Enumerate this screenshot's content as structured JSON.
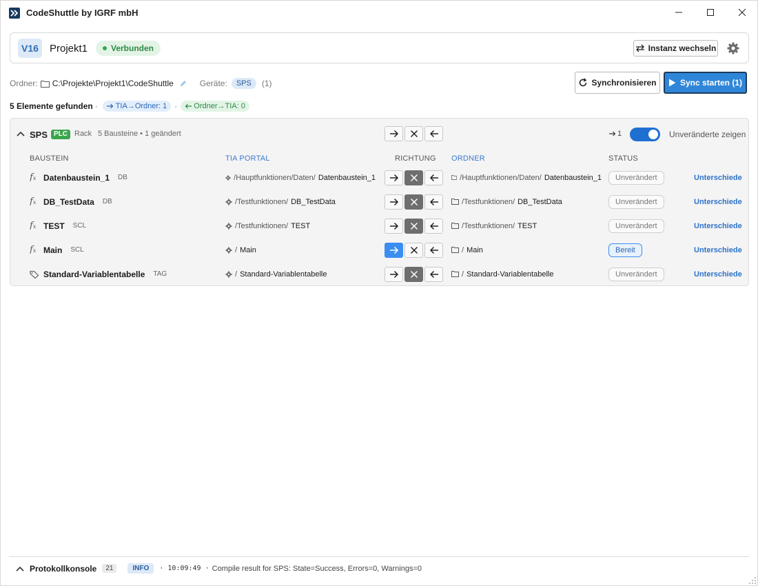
{
  "window": {
    "title": "CodeShuttle by IGRF mbH"
  },
  "header": {
    "version": "V16",
    "project": "Projekt1",
    "status": "Verbunden",
    "switch_label": "Instanz wechseln"
  },
  "info": {
    "folder_label": "Ordner:",
    "folder_path": "C:\\Projekte\\Projekt1\\CodeShuttle",
    "devices_label": "Geräte:",
    "device_chip": "SPS",
    "device_count": "(1)",
    "sync_label": "Synchronisieren",
    "start_label": "Sync starten (1)"
  },
  "summary": {
    "found": "5 Elemente gefunden",
    "sep1": "·",
    "sep2": "·",
    "tia_to_folder": "TIA→Ordner: 1",
    "folder_to_tia": "Ordner→TIA: 0"
  },
  "device": {
    "name": "SPS",
    "badge": "PLC",
    "rack": "Rack",
    "meta": "5 Bausteine • 1 geändert",
    "arrow_count": "1",
    "toggle_label": "Unveränderte zeigen",
    "show_unchanged": true
  },
  "columns": {
    "block": "BAUSTEIN",
    "tia": "TIA PORTAL",
    "direction": "RICHTUNG",
    "folder": "ORDNER",
    "status": "STATUS"
  },
  "rows": [
    {
      "name": "Datenbaustein_1",
      "type": "DB",
      "tia_path": "/Hauptfunktionen/Daten/",
      "tia_name": "Datenbaustein_1",
      "ord_path": "/Hauptfunktionen/Daten/",
      "ord_name": "Datenbaustein_1",
      "direction": "none",
      "status": "Unverändert",
      "diff": "Unterschiede"
    },
    {
      "name": "DB_TestData",
      "type": "DB",
      "tia_path": "/Testfunktionen/",
      "tia_name": "DB_TestData",
      "ord_path": "/Testfunktionen/",
      "ord_name": "DB_TestData",
      "direction": "none",
      "status": "Unverändert",
      "diff": "Unterschiede"
    },
    {
      "name": "TEST",
      "type": "SCL",
      "tia_path": "/Testfunktionen/",
      "tia_name": "TEST",
      "ord_path": "/Testfunktionen/",
      "ord_name": "TEST",
      "direction": "none",
      "status": "Unverändert",
      "diff": "Unterschiede"
    },
    {
      "name": "Main",
      "type": "SCL",
      "tia_path": "/",
      "tia_name": "Main",
      "ord_path": "/",
      "ord_name": "Main",
      "direction": "tia-to-folder",
      "status": "Bereit",
      "diff": "Unterschiede"
    },
    {
      "name": "Standard-Variablentabelle",
      "type": "TAG",
      "tia_path": "/",
      "tia_name": "Standard-Variablentabelle",
      "ord_path": "/",
      "ord_name": "Standard-Variablentabelle",
      "direction": "none",
      "status": "Unverändert",
      "diff": "Unterschiede"
    }
  ],
  "console": {
    "title": "Protokollkonsole",
    "count": "21",
    "level": "INFO",
    "time": "· 10:09:49 ·",
    "message": "Compile result for SPS: State=Success, Errors=0, Warnings=0"
  },
  "colors": {
    "accent": "#2f86d8",
    "connected": "#34a853",
    "plc": "#3aa54d",
    "link": "#2f72c8"
  }
}
